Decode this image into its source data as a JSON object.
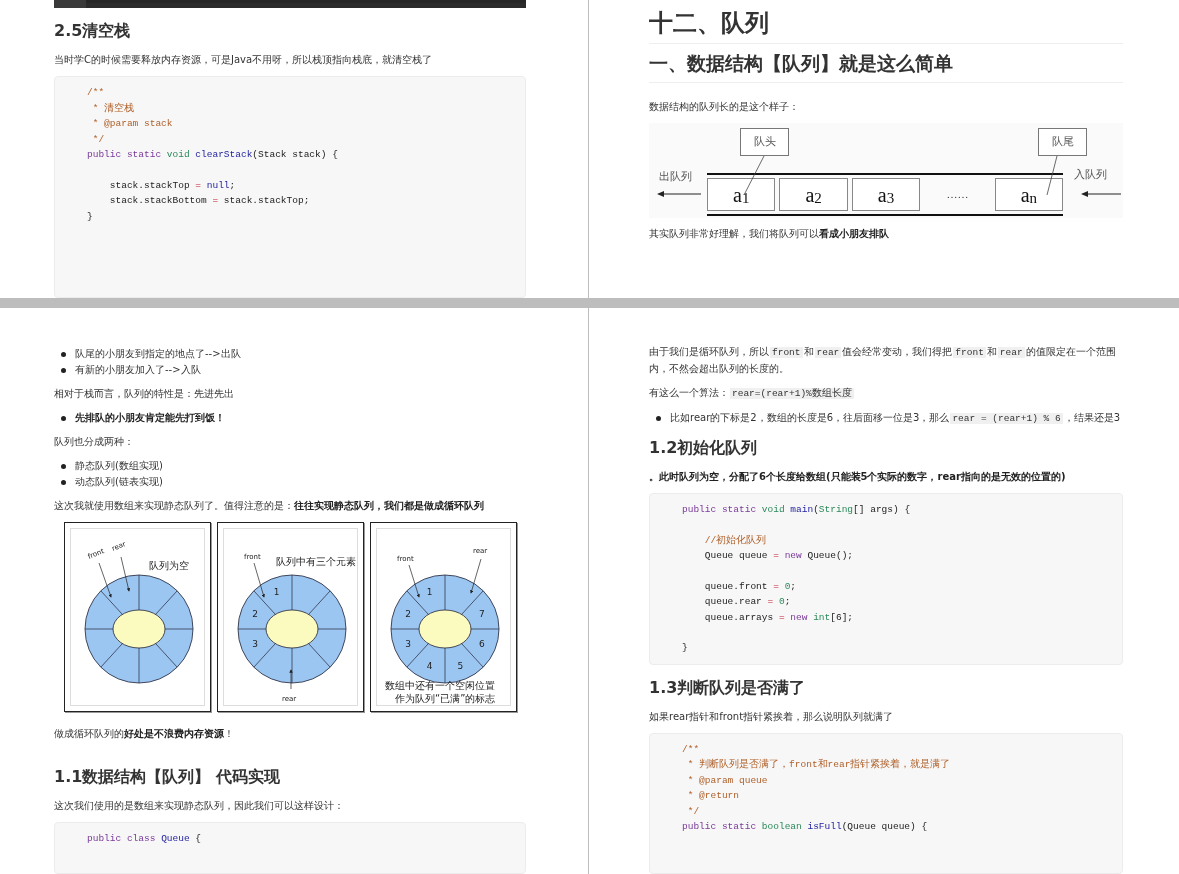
{
  "pages": [
    {
      "blocks": [
        {
          "kind": "picture"
        },
        {
          "kind": "heading",
          "text": "2.5清空栈"
        },
        {
          "kind": "paragraph",
          "segments": [
            {
              "kind": "text",
              "text": "当时学C的时候需要释放内存资源，可是Java不用呀，所以栈顶指向栈底，就清空栈了"
            }
          ]
        },
        {
          "kind": "code",
          "groups": [
            [
              [
                {
                  "kind": "comment",
                  "text": "/**"
                }
              ],
              [
                {
                  "kind": "comment",
                  "text": " * 清空栈"
                }
              ],
              [
                {
                  "kind": "comment",
                  "text": " * @param stack"
                }
              ],
              [
                {
                  "kind": "comment",
                  "text": " */"
                }
              ],
              [
                {
                  "kind": "keyword",
                  "text": "public static "
                },
                {
                  "kind": "type",
                  "text": "void "
                },
                {
                  "kind": "function",
                  "text": "clearStack"
                },
                {
                  "kind": "plain",
                  "text": "(Stack stack) {"
                }
              ]
            ],
            [
              [
                {
                  "kind": "plain",
                  "text": "    stack.stackTop "
                },
                {
                  "kind": "operator",
                  "text": "= "
                },
                {
                  "kind": "function",
                  "text": "null"
                },
                {
                  "kind": "plain",
                  "text": ";"
                }
              ],
              [
                {
                  "kind": "plain",
                  "text": "    stack.stackBottom "
                },
                {
                  "kind": "operator",
                  "text": "="
                },
                {
                  "kind": "plain",
                  "text": " stack.stackTop;"
                }
              ],
              [
                {
                  "kind": "plain",
                  "text": "}"
                }
              ]
            ]
          ]
        }
      ]
    },
    {
      "blocks": [
        {
          "kind": "title",
          "text": "十二、队列"
        },
        {
          "kind": "subtitle",
          "text": "一、数据结构【队列】就是这么简单"
        },
        {
          "kind": "paragraph",
          "segments": [
            {
              "kind": "text",
              "text": "数据结构的队列长的是这个样子："
            }
          ]
        },
        {
          "kind": "queue_diagram",
          "head_label": "队头",
          "tail_label": "队尾",
          "dequeue_label": "出队列",
          "enqueue_label": "入队列",
          "cells": [
            {
              "kind": "element",
              "text": "a$_{1}$"
            },
            {
              "kind": "element",
              "text": "a$_{2}$"
            },
            {
              "kind": "element",
              "text": "a$_{3}$"
            },
            {
              "kind": "ellipsis",
              "text": "……"
            },
            {
              "kind": "element",
              "text": "a$_{n}$"
            }
          ]
        },
        {
          "kind": "paragraph",
          "segments": [
            {
              "kind": "text",
              "text": "其实队列非常好理解，我们将队列可以"
            },
            {
              "kind": "bold",
              "text": "看成小朋友排队"
            }
          ]
        }
      ]
    },
    {
      "blocks": [
        {
          "kind": "bullets",
          "items": [
            [
              {
                "kind": "text",
                "text": "队尾的小朋友到指定的地点了-->出队"
              }
            ],
            [
              {
                "kind": "text",
                "text": "有新的小朋友加入了-->入队"
              }
            ]
          ]
        },
        {
          "kind": "paragraph",
          "segments": [
            {
              "kind": "text",
              "text": "相对于栈而言，队列的特性是：先进先出"
            }
          ]
        },
        {
          "kind": "bullets",
          "items": [
            [
              {
                "kind": "bold",
                "text": "先排队的小朋友肯定能先打到饭！"
              }
            ]
          ]
        },
        {
          "kind": "paragraph",
          "segments": [
            {
              "kind": "text",
              "text": "队列也分成两种："
            }
          ]
        },
        {
          "kind": "bullets",
          "items": [
            [
              {
                "kind": "text",
                "text": "静态队列(数组实现)"
              }
            ],
            [
              {
                "kind": "text",
                "text": "动态队列(链表实现)"
              }
            ]
          ]
        },
        {
          "kind": "paragraph",
          "segments": [
            {
              "kind": "text",
              "text": "这次我就使用数组来实现静态队列了。值得注意的是："
            },
            {
              "kind": "bold",
              "text": "往往实现静态队列，我们都是做成循环队列"
            }
          ]
        },
        {
          "kind": "ring_diagrams",
          "panels": [
            {
              "front": "front",
              "rear": "rear",
              "caption": "队列为空"
            },
            {
              "front": "front",
              "rear": "rear",
              "caption": "队列中有三个元素",
              "slot_numbers": [
                "1",
                "2",
                "3"
              ]
            },
            {
              "front": "front",
              "rear": "rear",
              "slot_numbers": [
                "1",
                "2",
                "3",
                "4",
                "5",
                "6",
                "7"
              ],
              "note": [
                "数组中还有一个空闲位置",
                "作为队列“已满”的标志"
              ]
            }
          ]
        },
        {
          "kind": "paragraph",
          "segments": [
            {
              "kind": "text",
              "text": "做成循环队列的"
            },
            {
              "kind": "bold",
              "text": "好处是不浪费内存资源"
            },
            {
              "kind": "text",
              "text": "！"
            }
          ]
        },
        {
          "kind": "heading",
          "text": "1.1数据结构【队列】 代码实现"
        },
        {
          "kind": "paragraph",
          "segments": [
            {
              "kind": "text",
              "text": "这次我们使用的是数组来实现静态队列，因此我们可以这样设计："
            }
          ]
        },
        {
          "kind": "code",
          "groups": [
            [
              [
                {
                  "kind": "keyword",
                  "text": "public class "
                },
                {
                  "kind": "function",
                  "text": "Queue"
                },
                {
                  "kind": "plain",
                  "text": " {"
                }
              ]
            ]
          ]
        }
      ]
    },
    {
      "blocks": [
        {
          "kind": "paragraph",
          "segments": [
            {
              "kind": "text",
              "text": "由于我们是循环队列，所以"
            },
            {
              "kind": "code",
              "text": "front"
            },
            {
              "kind": "text",
              "text": "和"
            },
            {
              "kind": "code",
              "text": "rear"
            },
            {
              "kind": "text",
              "text": "值会经常变动，我们得把"
            },
            {
              "kind": "code",
              "text": "front"
            },
            {
              "kind": "text",
              "text": "和"
            },
            {
              "kind": "code",
              "text": "rear"
            },
            {
              "kind": "text",
              "text": "的值限定在一个范围内，不然会超出队列的长度的。"
            }
          ]
        },
        {
          "kind": "paragraph",
          "segments": [
            {
              "kind": "text",
              "text": "有这么一个算法："
            },
            {
              "kind": "code",
              "text": "rear=(rear+1)%数组长度"
            }
          ]
        },
        {
          "kind": "bullets",
          "items": [
            [
              {
                "kind": "text",
                "text": "比如rear的下标是2，数组的长度是6，往后面移一位是3，那么"
              },
              {
                "kind": "code",
                "text": "rear = (rear+1) % 6"
              },
              {
                "kind": "text",
                "text": "，结果还是3"
              }
            ]
          ]
        },
        {
          "kind": "heading",
          "text": "1.2初始化队列"
        },
        {
          "kind": "paragraph",
          "segments": [
            {
              "kind": "bold",
              "text": "。此时队列为空，分配了6个长度给数组(只能装5个实际的数字，rear指向的是无效的位置的)"
            }
          ]
        },
        {
          "kind": "code",
          "groups": [
            [
              [
                {
                  "kind": "keyword",
                  "text": "public static "
                },
                {
                  "kind": "type",
                  "text": "void "
                },
                {
                  "kind": "function",
                  "text": "main"
                },
                {
                  "kind": "plain",
                  "text": "("
                },
                {
                  "kind": "type",
                  "text": "String"
                },
                {
                  "kind": "plain",
                  "text": "[] args) {"
                }
              ]
            ],
            [
              [
                {
                  "kind": "comment",
                  "text": "    //初始化队列"
                }
              ],
              [
                {
                  "kind": "plain",
                  "text": "    Queue queue "
                },
                {
                  "kind": "operator",
                  "text": "= "
                },
                {
                  "kind": "keyword",
                  "text": "new"
                },
                {
                  "kind": "plain",
                  "text": " Queue();"
                }
              ]
            ],
            [
              [
                {
                  "kind": "plain",
                  "text": "    queue.front "
                },
                {
                  "kind": "operator",
                  "text": "= "
                },
                {
                  "kind": "number",
                  "text": "0"
                },
                {
                  "kind": "plain",
                  "text": ";"
                }
              ],
              [
                {
                  "kind": "plain",
                  "text": "    queue.rear "
                },
                {
                  "kind": "operator",
                  "text": "= "
                },
                {
                  "kind": "number",
                  "text": "0"
                },
                {
                  "kind": "plain",
                  "text": ";"
                }
              ],
              [
                {
                  "kind": "plain",
                  "text": "    queue.arrays "
                },
                {
                  "kind": "operator",
                  "text": "= "
                },
                {
                  "kind": "keyword",
                  "text": "new "
                },
                {
                  "kind": "type",
                  "text": "int"
                },
                {
                  "kind": "plain",
                  "text": "[6];"
                }
              ]
            ],
            [
              [
                {
                  "kind": "plain",
                  "text": "}"
                }
              ]
            ]
          ]
        },
        {
          "kind": "heading",
          "text": "1.3判断队列是否满了"
        },
        {
          "kind": "paragraph",
          "segments": [
            {
              "kind": "text",
              "text": "如果rear指针和front指针紧挨着，那么说明队列就满了"
            }
          ]
        },
        {
          "kind": "code",
          "groups": [
            [
              [
                {
                  "kind": "comment",
                  "text": "/**"
                }
              ],
              [
                {
                  "kind": "comment",
                  "text": " * 判断队列是否满了，front和rear指针紧挨着，就是满了"
                }
              ],
              [
                {
                  "kind": "comment",
                  "text": " * @param queue"
                }
              ],
              [
                {
                  "kind": "comment",
                  "text": " * @return"
                }
              ],
              [
                {
                  "kind": "comment",
                  "text": " */"
                }
              ],
              [
                {
                  "kind": "keyword",
                  "text": "public static "
                },
                {
                  "kind": "type",
                  "text": "boolean "
                },
                {
                  "kind": "function",
                  "text": "isFull"
                },
                {
                  "kind": "plain",
                  "text": "(Queue queue) {"
                }
              ]
            ]
          ]
        }
      ]
    }
  ]
}
